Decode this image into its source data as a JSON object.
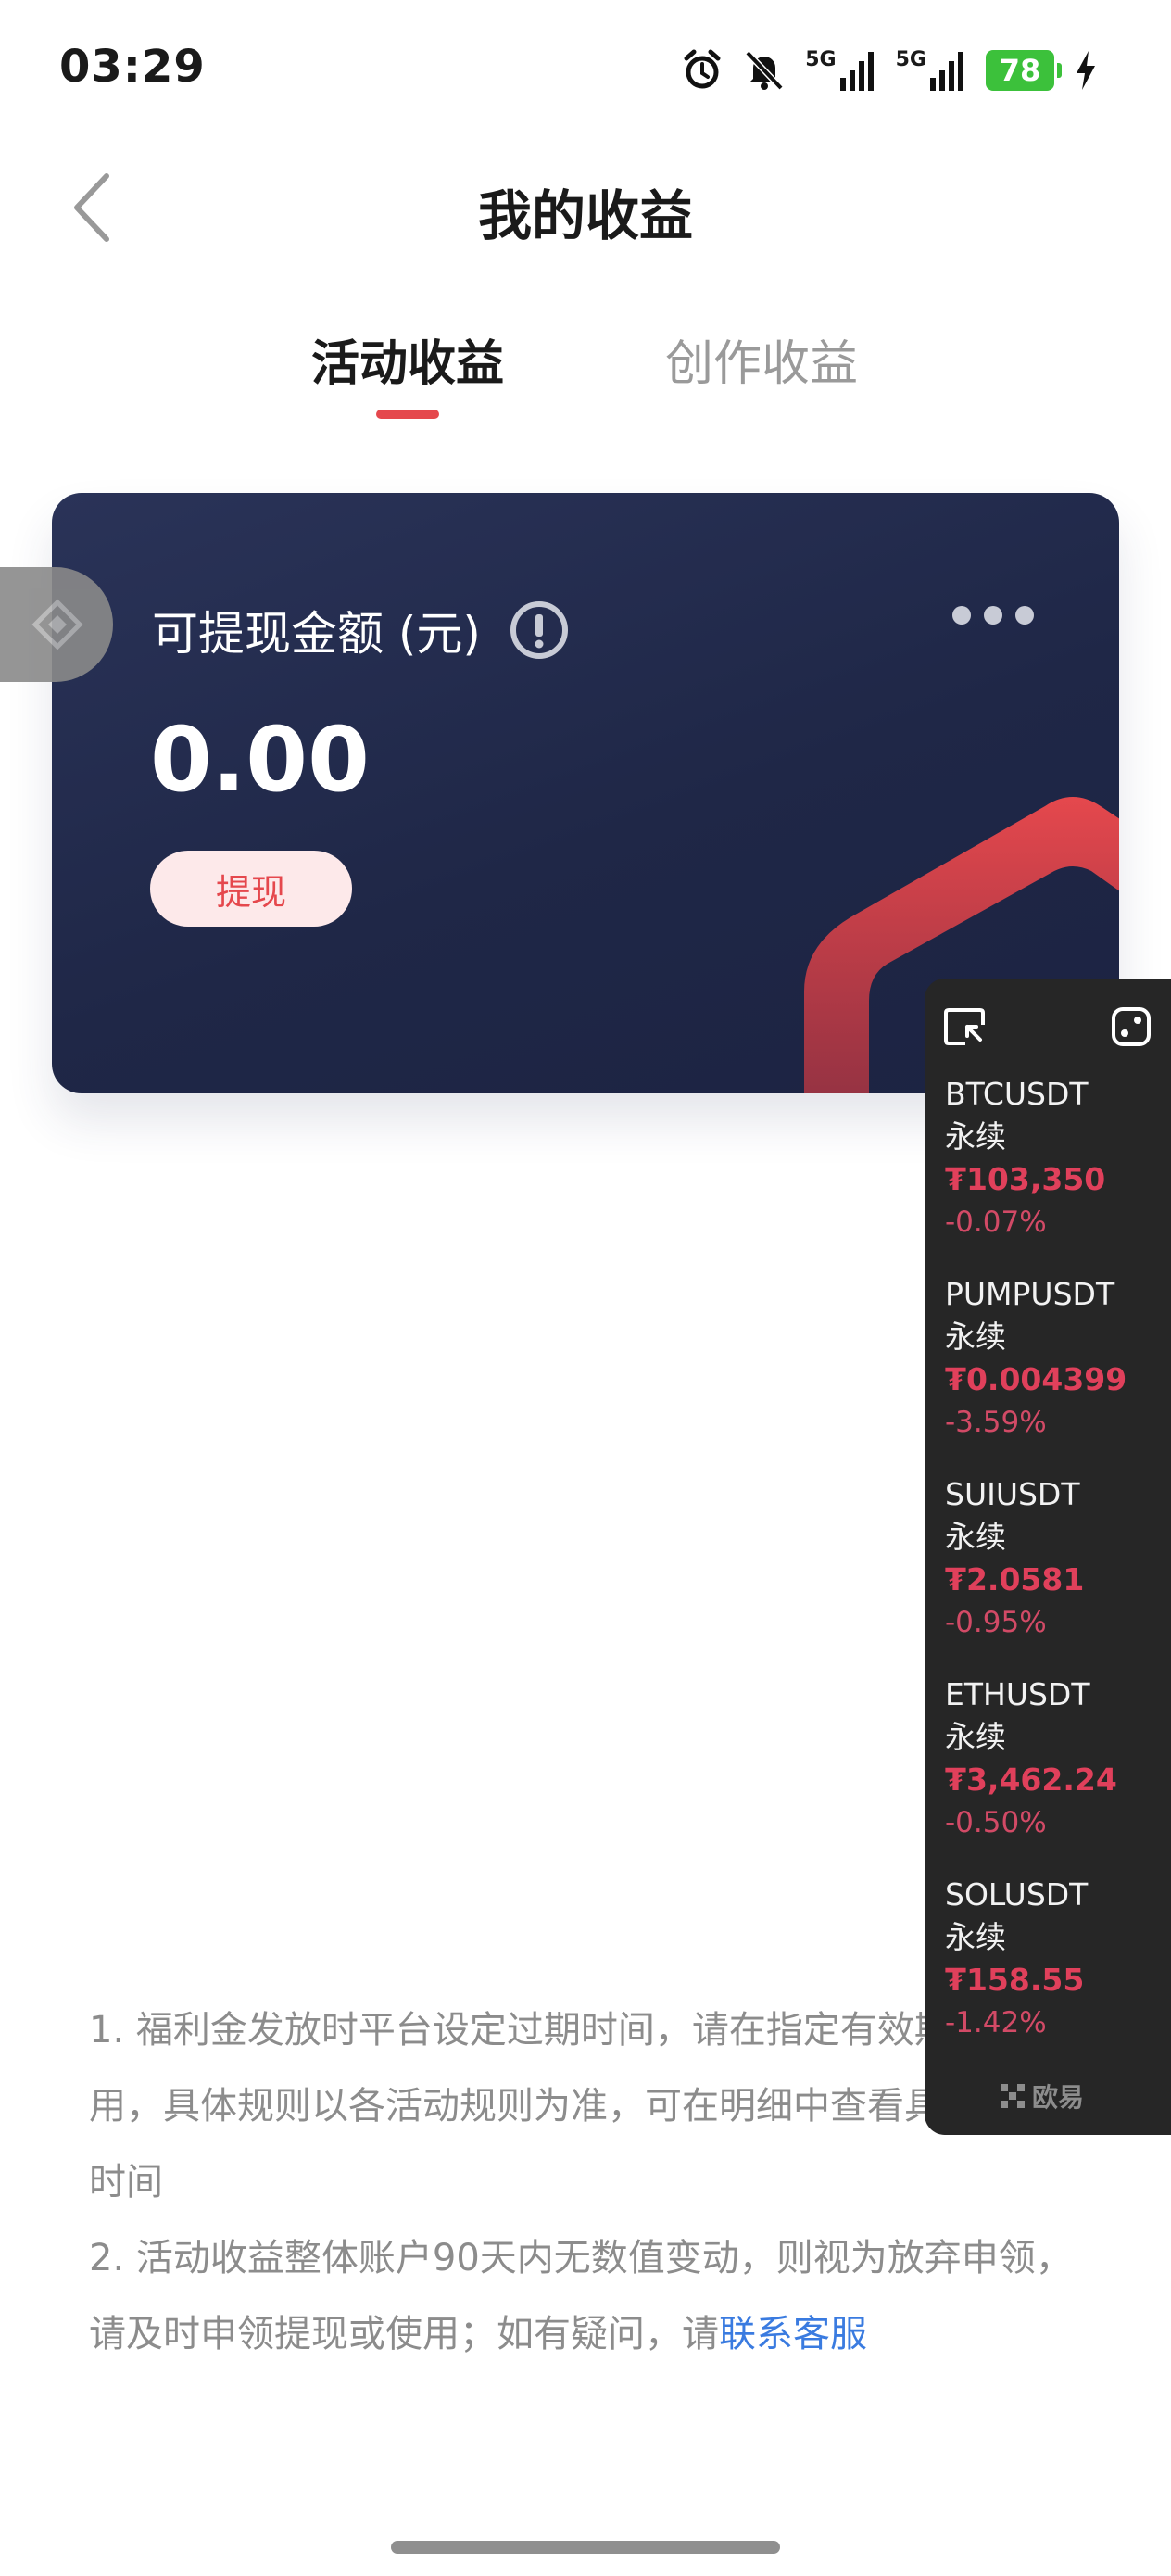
{
  "status_bar": {
    "time": "03:29",
    "network_1": "5G",
    "network_2": "5G",
    "battery": "78",
    "icons": [
      "alarm-icon",
      "bell-muted-icon",
      "signal-icon",
      "signal-icon",
      "battery-icon",
      "charging-icon"
    ]
  },
  "header": {
    "title": "我的收益",
    "back_icon": "chevron-left-icon"
  },
  "tabs": [
    {
      "label": "活动收益",
      "active": true
    },
    {
      "label": "创作收益",
      "active": false
    }
  ],
  "card": {
    "label": "可提现金额 (元)",
    "amount": "0.00",
    "withdraw_label": "提现",
    "accent_color": "#e5484d"
  },
  "rules": {
    "line1": "1. 福利金发放时平台设定过期时间，请在指定有效期内使用，具体规则以各活动规则为准，可在明细中查看具体的过期时间",
    "line2_prefix": "2. 活动收益整体账户90天内无数值变动，则视为放弃申领，请及时申领提现或使用；如有疑问，请",
    "link": "联系客服"
  },
  "ticker_panel": {
    "brand": "欧易",
    "items": [
      {
        "symbol": "BTCUSDT",
        "type": "永续",
        "price": "₮103,350",
        "change": "-0.07%"
      },
      {
        "symbol": "PUMPUSDT",
        "type": "永续",
        "price": "₮0.004399",
        "change": "-3.59%"
      },
      {
        "symbol": "SUIUSDT",
        "type": "永续",
        "price": "₮2.0581",
        "change": "-0.95%"
      },
      {
        "symbol": "ETHUSDT",
        "type": "永续",
        "price": "₮3,462.24",
        "change": "-0.50%"
      },
      {
        "symbol": "SOLUSDT",
        "type": "永续",
        "price": "₮158.55",
        "change": "-1.42%"
      }
    ]
  }
}
